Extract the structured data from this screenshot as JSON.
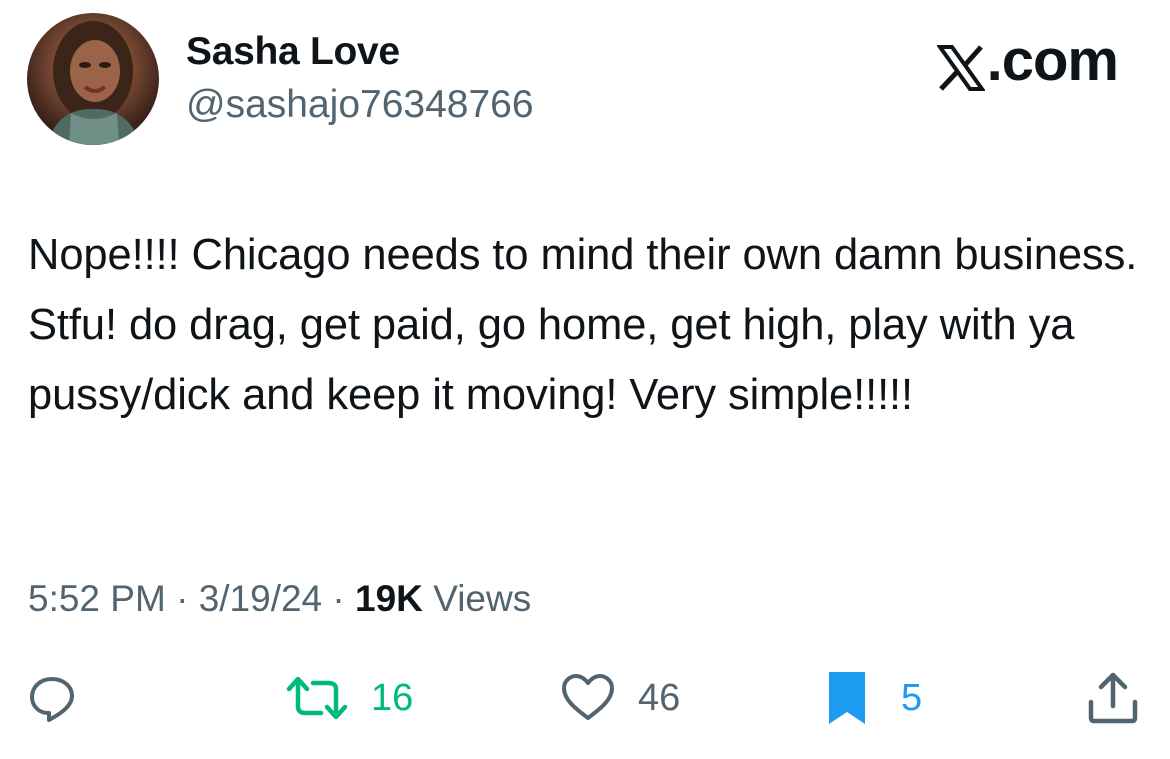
{
  "author": {
    "display_name": "Sasha Love",
    "handle": "@sashajo76348766"
  },
  "brand": {
    "label": ".com",
    "icon": "x-logo-icon"
  },
  "tweet": {
    "text": "Nope!!!! Chicago needs to mind their own damn business. Stfu! do drag, get paid, go home, get high, play with ya pussy/dick and keep it moving! Very simple!!!!!"
  },
  "meta": {
    "time": "5:52 PM",
    "separator": "·",
    "date": "3/19/24",
    "views_count": "19K",
    "views_label": "Views"
  },
  "actions": {
    "reply": {
      "icon": "reply-icon"
    },
    "repost": {
      "icon": "repost-icon",
      "count": "16",
      "color": "#00ba7c"
    },
    "like": {
      "icon": "heart-icon",
      "count": "46"
    },
    "bookmark": {
      "icon": "bookmark-icon",
      "count": "5",
      "color": "#1d9bf0"
    },
    "share": {
      "icon": "share-icon"
    }
  },
  "colors": {
    "text_primary": "#0f1419",
    "text_secondary": "#536471",
    "accent_blue": "#1d9bf0",
    "accent_green": "#00ba7c"
  }
}
